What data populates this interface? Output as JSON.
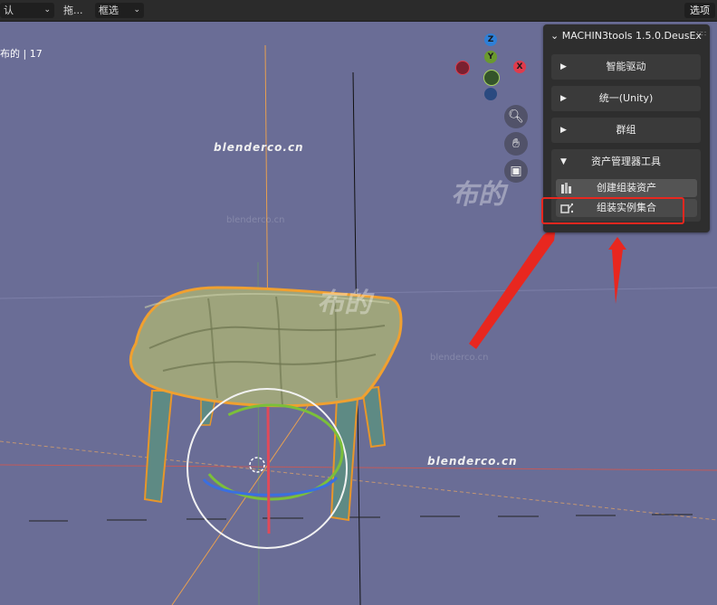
{
  "topbar": {
    "mode_dropdown": "认",
    "drag_label": "拖...",
    "select_dropdown": "框选",
    "options_label": "选项"
  },
  "viewport": {
    "view_label": "布的 | 17",
    "watermark_text": "blenderco.cn",
    "watermark_big": "布的",
    "watermark_small": "blenderco.cn"
  },
  "gizmo": {
    "z_label": "Z",
    "y_label": "Y",
    "x_label": "X",
    "colors": {
      "x": "#e03b4c",
      "y": "#6a9a2e",
      "z": "#2f7fd6",
      "neg": "#7a2030"
    }
  },
  "nav_icons": [
    "zoom-icon",
    "hand-icon",
    "camera-icon"
  ],
  "npanel": {
    "title": "MACHIN3tools 1.5.0.DeusEx",
    "sections": [
      {
        "label": "智能驱动",
        "expanded": false
      },
      {
        "label": "统一(Unity)",
        "expanded": false
      },
      {
        "label": "群组",
        "expanded": false
      },
      {
        "label": "资产管理器工具",
        "expanded": true
      }
    ],
    "buttons": [
      {
        "label": "创建组装资产",
        "icon": "asset-icon"
      },
      {
        "label": "组装实例集合",
        "icon": "collection-icon"
      }
    ]
  },
  "annotation": {
    "highlight_color": "#e8271f"
  }
}
